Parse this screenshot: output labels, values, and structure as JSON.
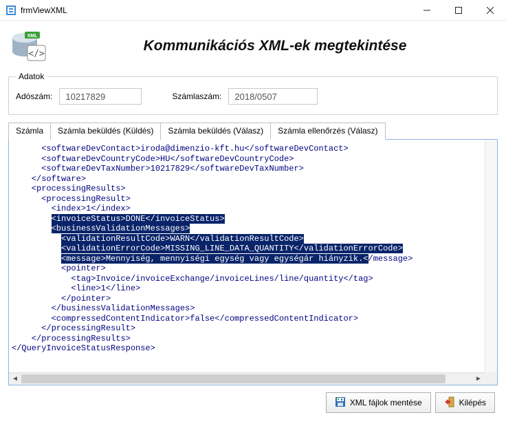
{
  "window": {
    "title": "frmViewXML"
  },
  "heading": "Kommunikációs XML-ek megtekintése",
  "group": {
    "legend": "Adatok",
    "adoszam_label": "Adószám:",
    "adoszam_value": "10217829",
    "szamlaszam_label": "Számlaszám:",
    "szamlaszam_value": "2018/0507"
  },
  "tabs": [
    {
      "label": "Számla"
    },
    {
      "label": "Számla beküldés (Küldés)"
    },
    {
      "label": "Számla beküldés (Válasz)"
    },
    {
      "label": "Számla ellenőrzés (Válasz)"
    }
  ],
  "active_tab_index": 3,
  "xml_lines": [
    {
      "indent": 3,
      "text": "<softwareDevContact>iroda@dimenzio-kft.hu</softwareDevContact>"
    },
    {
      "indent": 3,
      "text": "<softwareDevCountryCode>HU</softwareDevCountryCode>"
    },
    {
      "indent": 3,
      "text": "<softwareDevTaxNumber>10217829</softwareDevTaxNumber>"
    },
    {
      "indent": 2,
      "text": "</software>"
    },
    {
      "indent": 2,
      "text": "<processingResults>"
    },
    {
      "indent": 3,
      "text": "<processingResult>"
    },
    {
      "indent": 4,
      "text": "<index>1</index>"
    },
    {
      "indent": 4,
      "text": "<invoiceStatus>DONE</invoiceStatus>",
      "selected": true
    },
    {
      "indent": 4,
      "text": "<businessValidationMessages>",
      "selected": true
    },
    {
      "indent": 5,
      "text": "<validationResultCode>WARN</validationResultCode>",
      "selected": true
    },
    {
      "indent": 5,
      "text": "<validationErrorCode>MISSING_LINE_DATA_QUANTITY</validationErrorCode>",
      "selected": true
    },
    {
      "indent": 5,
      "mixed": true,
      "sel_prefix": "<message>Mennyiség, mennyiségi egység vagy egységár hiányzik.<",
      "rest": "/message>"
    },
    {
      "indent": 5,
      "text": "<pointer>"
    },
    {
      "indent": 6,
      "text": "<tag>Invoice/invoiceExchange/invoiceLines/line/quantity</tag>"
    },
    {
      "indent": 6,
      "text": "<line>1</line>"
    },
    {
      "indent": 5,
      "text": "</pointer>"
    },
    {
      "indent": 4,
      "text": "</businessValidationMessages>"
    },
    {
      "indent": 4,
      "text": "<compressedContentIndicator>false</compressedContentIndicator>"
    },
    {
      "indent": 3,
      "text": "</processingResult>"
    },
    {
      "indent": 2,
      "text": "</processingResults>"
    },
    {
      "indent": 0,
      "text": "</QueryInvoiceStatusResponse>"
    }
  ],
  "footer": {
    "save_label": "XML fájlok mentése",
    "exit_label": "Kilépés"
  }
}
